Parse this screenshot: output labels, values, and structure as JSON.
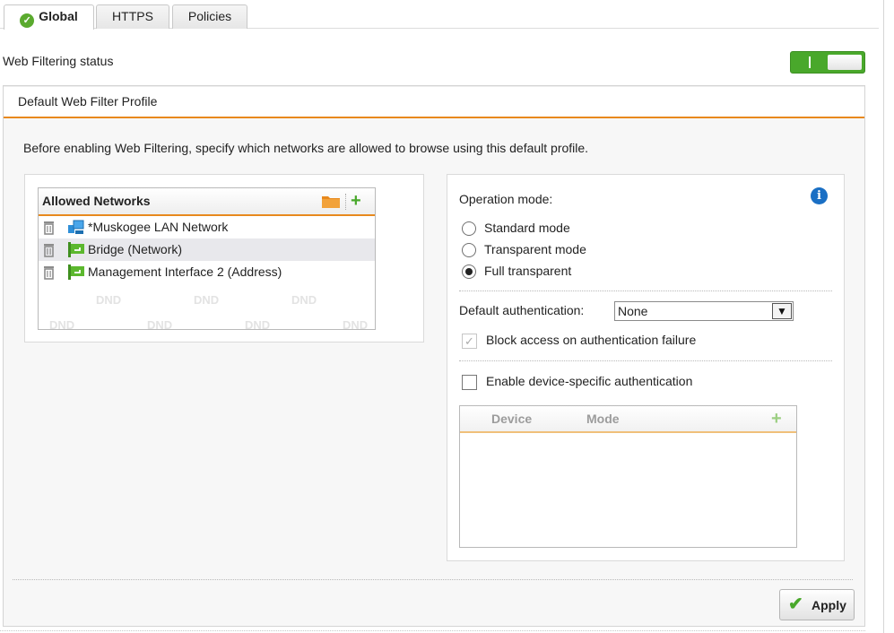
{
  "tabs": [
    {
      "label": "Global",
      "active": true
    },
    {
      "label": "HTTPS",
      "active": false
    },
    {
      "label": "Policies",
      "active": false
    }
  ],
  "status": {
    "label": "Web Filtering status",
    "toggle_on_label": "I",
    "enabled": true
  },
  "profile": {
    "title": "Default Web Filter Profile",
    "intro": "Before enabling Web Filtering, specify which networks are allowed to browse using this default profile."
  },
  "allowed_networks": {
    "title": "Allowed Networks",
    "items": [
      {
        "label": "*Muskogee LAN Network",
        "icon": "network-icon"
      },
      {
        "label": "Bridge (Network)",
        "icon": "bridge-network-icon"
      },
      {
        "label": "Management Interface 2 (Address)",
        "icon": "interface-address-icon"
      }
    ],
    "watermark": "DND"
  },
  "operation": {
    "label": "Operation mode:",
    "options": [
      "Standard mode",
      "Transparent mode",
      "Full transparent"
    ],
    "selected": "Full transparent"
  },
  "auth": {
    "label": "Default authentication:",
    "value": "None",
    "block_label": "Block access on authentication failure",
    "block_checked": true,
    "device_label": "Enable device-specific authentication",
    "device_checked": false
  },
  "device_table": {
    "columns": [
      "Device",
      "Mode"
    ]
  },
  "apply_label": "Apply",
  "colors": {
    "accent": "#e8891d",
    "green": "#49a82b",
    "info": "#1a6fc4"
  }
}
